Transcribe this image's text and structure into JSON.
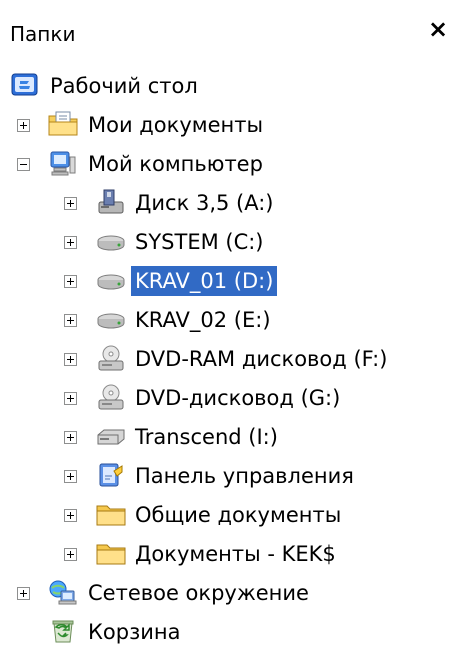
{
  "panel": {
    "title": "Папки",
    "close_label": "×"
  },
  "tree": {
    "desktop": "Рабочий стол",
    "my_documents": "Мои документы",
    "my_computer": "Мой компьютер",
    "drive_a": "Диск 3,5 (A:)",
    "drive_c": "SYSTEM (C:)",
    "drive_d": "KRAV_01 (D:)",
    "drive_e": "KRAV_02 (E:)",
    "drive_f": "DVD-RAM дисковод (F:)",
    "drive_g": "DVD-дисковод (G:)",
    "drive_i": "Transcend (I:)",
    "control_panel": "Панель управления",
    "shared_documents": "Общие документы",
    "kek_documents": "Документы - KEK$",
    "network": "Сетевое окружение",
    "recycle_bin": "Корзина"
  }
}
